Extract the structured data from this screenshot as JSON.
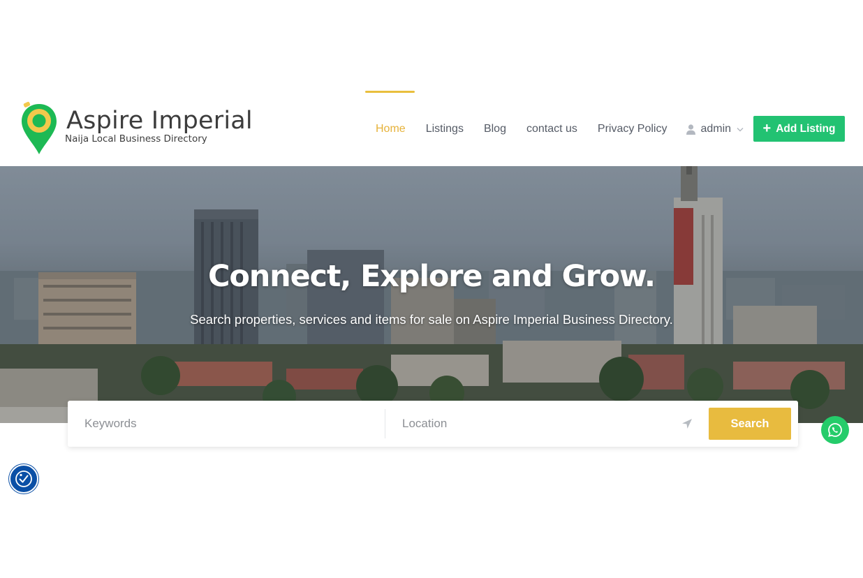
{
  "brand": {
    "name": "Aspire Imperial",
    "tagline": "Naija Local Business Directory",
    "pin_color": "#1db954",
    "ring_color": "#f2c94c"
  },
  "nav": {
    "items": [
      {
        "label": "Home",
        "active": true
      },
      {
        "label": "Listings",
        "active": false
      },
      {
        "label": "Blog",
        "active": false
      },
      {
        "label": "contact us",
        "active": false
      },
      {
        "label": "Privacy Policy",
        "active": false
      }
    ],
    "user_label": "admin",
    "user_icon": "user-icon",
    "active_color": "#e6b23a"
  },
  "add_listing": {
    "label": "Add Listing",
    "icon": "plus-icon",
    "color": "#22c272"
  },
  "hero": {
    "title": "Connect, Explore and Grow.",
    "subtitle": "Search properties, services and items for sale on Aspire Imperial Business Directory."
  },
  "search": {
    "keywords_placeholder": "Keywords",
    "keywords_value": "",
    "location_placeholder": "Location",
    "location_value": "",
    "locate_icon": "location-arrow-icon",
    "button_label": "Search",
    "button_color": "#e8bb3f"
  },
  "floating": {
    "whatsapp_icon": "whatsapp-icon",
    "whatsapp_color": "#25cc6a",
    "accessibility_icon": "accessibility-icon",
    "accessibility_color": "#0a4fa6"
  }
}
